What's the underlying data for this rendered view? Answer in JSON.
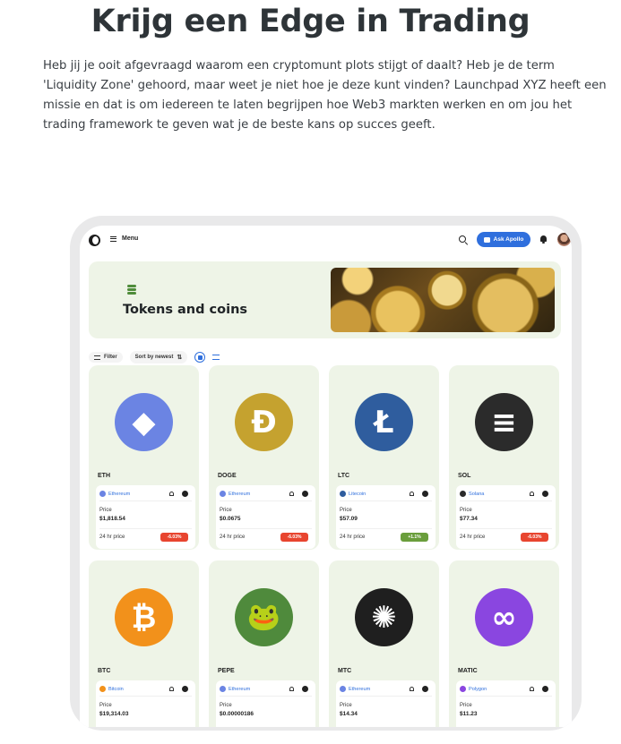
{
  "hero": {
    "title": "Krijg een Edge in Trading",
    "text": "Heb jij je ooit afgevraagd waarom een cryptomunt plots stijgt of daalt? Heb je de term 'Liquidity Zone' gehoord, maar weet je niet hoe je deze kunt vinden? Launchpad XYZ heeft een missie en dat is om iedereen te laten begrijpen hoe Web3 markten werken en om jou het trading framework te geven wat je de beste kans op succes geeft."
  },
  "app": {
    "menu_label": "Menu",
    "ask_button": "Ask Apollo",
    "banner_title": "Tokens and coins",
    "filter_label": "Filter",
    "sort_label": "Sort by newest",
    "price_label": "Price",
    "change_label": "24 hr price"
  },
  "colors": {
    "accent": "#2f6fdd",
    "card_bg": "#eef4e7",
    "negative": "#e8452f",
    "positive": "#6a9e3c"
  },
  "tokens": [
    {
      "symbol": "ETH",
      "chain": "Ethereum",
      "price": "$1,818.54",
      "change": "-6.03%",
      "trend": "down",
      "logo_color": "#6b84e3",
      "glyph": "◆",
      "chain_color": "#6b84e3"
    },
    {
      "symbol": "DOGE",
      "chain": "Ethereum",
      "price": "$0.0675",
      "change": "-6.03%",
      "trend": "down",
      "logo_color": "#c5a22f",
      "glyph": "Ð",
      "chain_color": "#6b84e3"
    },
    {
      "symbol": "LTC",
      "chain": "Litecoin",
      "price": "$57.09",
      "change": "+1.1%",
      "trend": "up",
      "logo_color": "#2f5d9e",
      "glyph": "Ł",
      "chain_color": "#2f5d9e"
    },
    {
      "symbol": "SOL",
      "chain": "Solana",
      "price": "$77.34",
      "change": "-6.03%",
      "trend": "down",
      "logo_color": "#2b2b2b",
      "glyph": "≡",
      "chain_color": "#2b2b2b"
    },
    {
      "symbol": "BTC",
      "chain": "Bitcoin",
      "price": "$19,314.03",
      "change": "",
      "trend": "",
      "logo_color": "#f2911b",
      "glyph": "₿",
      "chain_color": "#f2911b"
    },
    {
      "symbol": "PEPE",
      "chain": "Ethereum",
      "price": "$0.00000186",
      "change": "",
      "trend": "",
      "logo_color": "#4f8a3c",
      "glyph": "🐸",
      "chain_color": "#6b84e3"
    },
    {
      "symbol": "MTC",
      "chain": "Ethereum",
      "price": "$14.34",
      "change": "",
      "trend": "",
      "logo_color": "#1f1f1f",
      "glyph": "✺",
      "chain_color": "#6b84e3"
    },
    {
      "symbol": "MATIC",
      "chain": "Polygon",
      "price": "$11.23",
      "change": "",
      "trend": "",
      "logo_color": "#8a46e0",
      "glyph": "∞",
      "chain_color": "#8a46e0"
    }
  ]
}
